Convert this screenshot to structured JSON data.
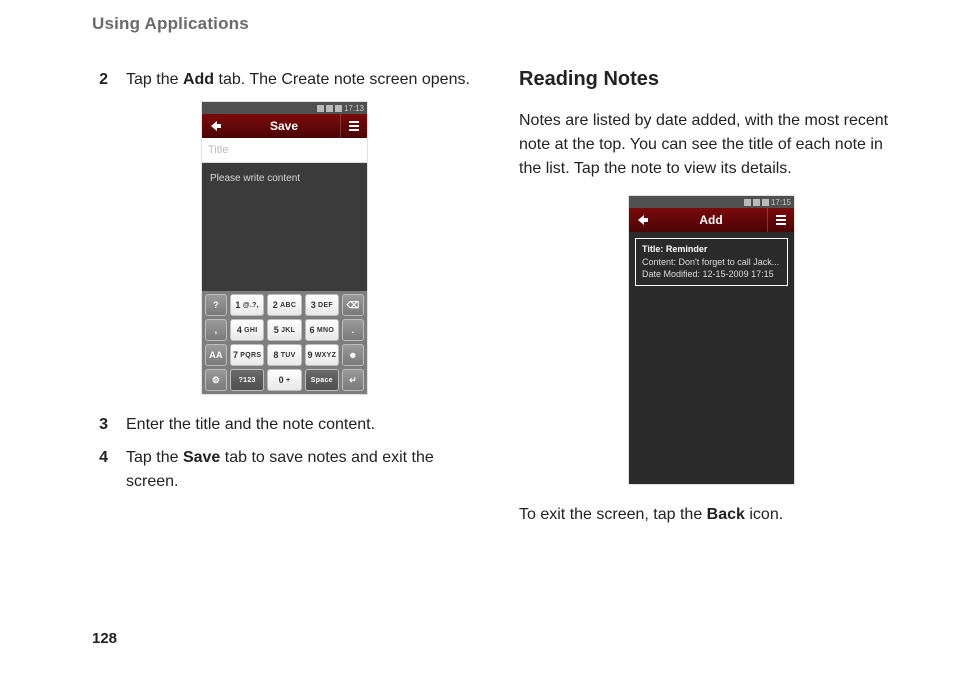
{
  "header": "Using Applications",
  "page_number": "128",
  "left": {
    "steps": [
      {
        "n": "2",
        "pre": "Tap the ",
        "bold": "Add",
        "post": " tab. The Create note screen opens."
      },
      {
        "n": "3",
        "pre": "Enter the title and the note content.",
        "bold": "",
        "post": ""
      },
      {
        "n": "4",
        "pre": "Tap the ",
        "bold": "Save",
        "post": " tab to save notes and exit the screen."
      }
    ],
    "phone": {
      "time": "17:13",
      "topbar_center": "Save",
      "title_placeholder": "Title",
      "content_placeholder": "Please write content",
      "keys": {
        "r1": {
          "side_l": "?",
          "k1a": "1",
          "k1b": "@.?,",
          "k2a": "2",
          "k2b": "ABC",
          "k3a": "3",
          "k3b": "DEF",
          "side_r": "⌫"
        },
        "r2": {
          "side_l": ",",
          "k1a": "4",
          "k1b": "GHI",
          "k2a": "5",
          "k2b": "JKL",
          "k3a": "6",
          "k3b": "MNO",
          "side_r": "."
        },
        "r3": {
          "side_l": "AA",
          "k1a": "7",
          "k1b": "PQRS",
          "k2a": "8",
          "k2b": "TUV",
          "k3a": "9",
          "k3b": "WXYZ",
          "side_r": "☻"
        },
        "r4": {
          "side_l": "⚙",
          "k1": "?123",
          "k2a": "0",
          "k2b": "+",
          "k3": "Space",
          "side_r": "↵"
        }
      }
    }
  },
  "right": {
    "heading": "Reading Notes",
    "para": "Notes are listed by date added, with the most recent note at the top. You can see the title of each note in the list. Tap the note to view its details.",
    "exit_pre": "To exit the screen, tap the ",
    "exit_bold": "Back",
    "exit_post": " icon.",
    "phone": {
      "time": "17:15",
      "topbar_center": "Add",
      "note": {
        "title_label": "Title: ",
        "title": "Reminder",
        "content_label": "Content: ",
        "content": "Don't forget to call Jack...",
        "date_label": "Date Modified: ",
        "date": "12-15-2009 17:15"
      }
    }
  }
}
